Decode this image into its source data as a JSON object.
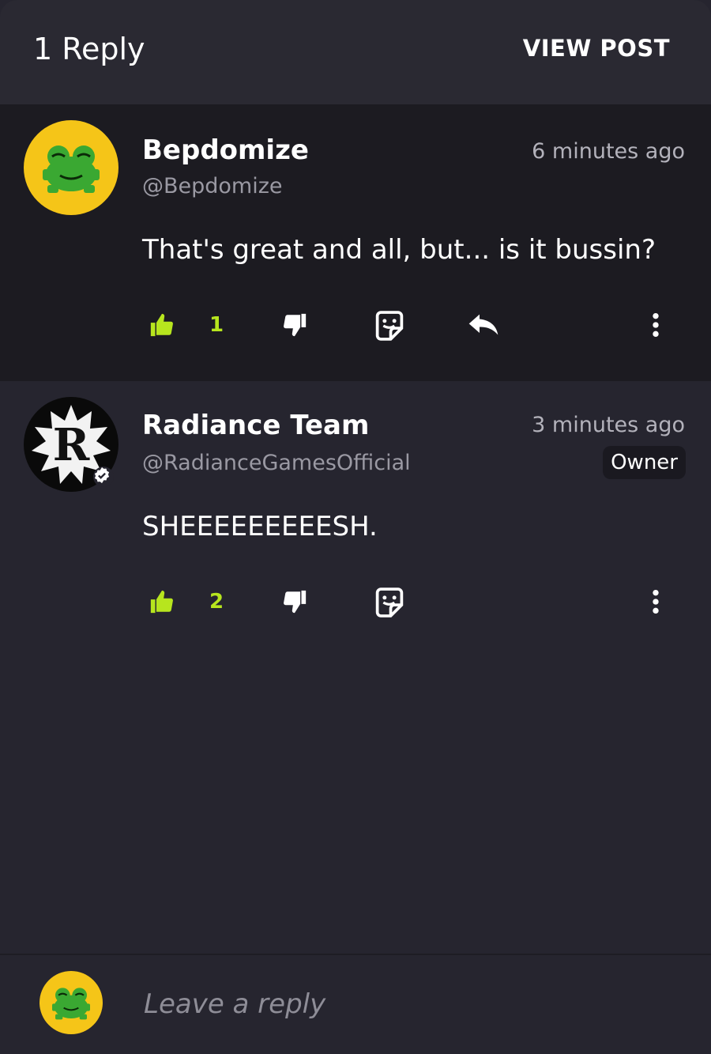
{
  "header": {
    "title": "1 Reply",
    "view_post_label": "VIEW POST"
  },
  "comments": [
    {
      "name": "Bepdomize",
      "handle": "@Bepdomize",
      "time": "6 minutes ago",
      "text": "That's great and all, but... is it bussin?",
      "likes": "1",
      "avatar_icon": "frog-avatar-icon"
    },
    {
      "name": "Radiance Team",
      "handle": "@RadianceGamesOfficial",
      "time": "3 minutes ago",
      "badge": "Owner",
      "text": "SHEEEEEEEEESH.",
      "likes": "2",
      "avatar_icon": "radiance-logo-icon",
      "avatar_letter": "R"
    }
  ],
  "composer": {
    "placeholder": "Leave a reply"
  },
  "colors": {
    "accent_green": "#b7e51e",
    "background": "#26252f",
    "highlight_row": "#1c1b21",
    "avatar_yellow": "#f5c518"
  }
}
